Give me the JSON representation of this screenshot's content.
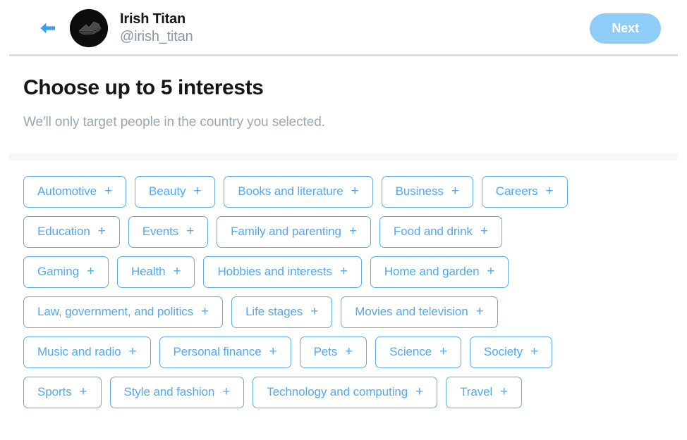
{
  "header": {
    "back_icon": "arrow-left-icon",
    "avatar_icon": "irish-titan-logo-avatar",
    "account_name": "Irish Titan",
    "account_handle": "@irish_titan",
    "next_label": "Next",
    "next_button_color": "#8ecdf7",
    "divider_color": "#d6dde2"
  },
  "intro": {
    "title": "Choose up to 5 interests",
    "subtitle": "We'll only target people in the country you selected.",
    "max_interests": 5
  },
  "interests": {
    "plus_glyph": "+",
    "accent_color": "#53a8ee",
    "border_color": "#5dade9",
    "rows": [
      [
        {
          "label": "Automotive"
        },
        {
          "label": "Beauty"
        },
        {
          "label": "Books and literature"
        },
        {
          "label": "Business"
        },
        {
          "label": "Careers"
        }
      ],
      [
        {
          "label": "Education"
        },
        {
          "label": "Events"
        },
        {
          "label": "Family and parenting"
        },
        {
          "label": "Food and drink"
        }
      ],
      [
        {
          "label": "Gaming"
        },
        {
          "label": "Health"
        },
        {
          "label": "Hobbies and interests"
        },
        {
          "label": "Home and garden"
        }
      ],
      [
        {
          "label": "Law, government, and politics"
        },
        {
          "label": "Life stages"
        },
        {
          "label": "Movies and television"
        }
      ],
      [
        {
          "label": "Music and radio"
        },
        {
          "label": "Personal finance"
        },
        {
          "label": "Pets"
        },
        {
          "label": "Science"
        },
        {
          "label": "Society"
        }
      ],
      [
        {
          "label": "Sports"
        },
        {
          "label": "Style and fashion"
        },
        {
          "label": "Technology and computing"
        },
        {
          "label": "Travel"
        }
      ]
    ]
  }
}
